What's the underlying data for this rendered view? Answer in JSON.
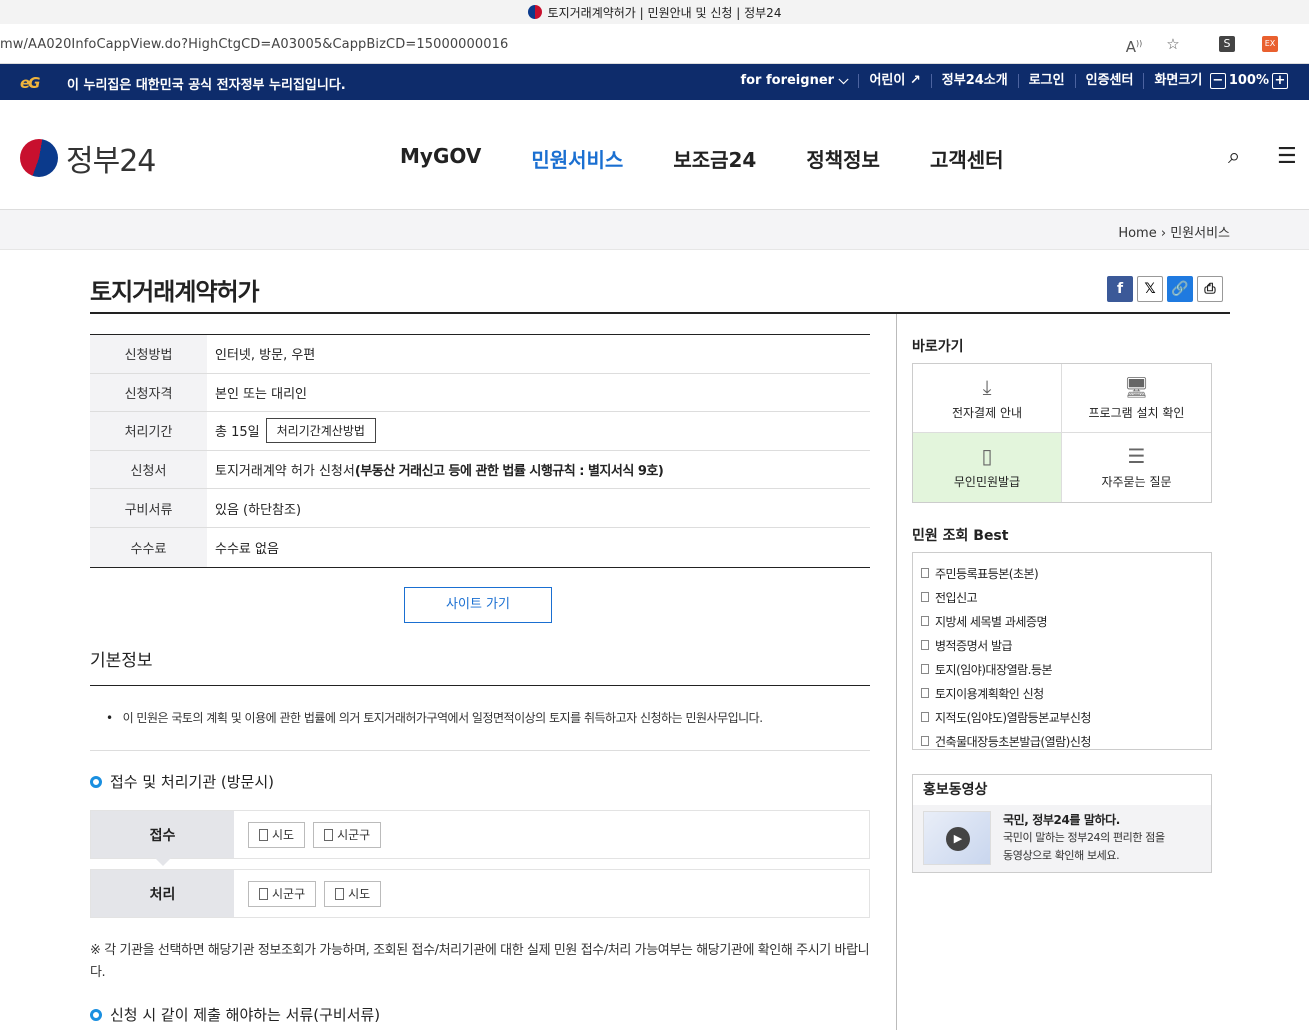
{
  "browser": {
    "window_title": "토지거래계약허가 | 민원안내 및 신청 | 정부24",
    "url": "mw/AA020InfoCappView.do?HighCtgCD=A03005&CappBizCD=15000000016",
    "ext_s": "S",
    "ext_ex": "EX"
  },
  "gov_banner": {
    "logo_text": "eG",
    "notice": "이 누리집은 대한민국 공식 전자정부 누리집입니다.",
    "foreigner": "for foreigner",
    "kids": "어린이",
    "about": "정부24소개",
    "login": "로그인",
    "cert": "인증센터",
    "screen_size": "화면크기",
    "zoom": "100%"
  },
  "header": {
    "logo": "정부24",
    "nav": [
      "MyGOV",
      "민원서비스",
      "보조금24",
      "정책정보",
      "고객센터"
    ],
    "active_index": 1
  },
  "breadcrumb": {
    "home": "Home",
    "current": "민원서비스"
  },
  "page": {
    "title": "토지거래계약허가",
    "info_rows": [
      {
        "label": "신청방법",
        "value": "인터넷, 방문, 우편"
      },
      {
        "label": "신청자격",
        "value": "본인 또는 대리인"
      },
      {
        "label": "처리기간",
        "value": "총 15일",
        "button": "처리기간계산방법"
      },
      {
        "label": "신청서",
        "value": "토지거래계약 허가 신청서 ",
        "value_bold": "(부동산 거래신고 등에 관한 법률 시행규칙 : 별지서식 9호)"
      },
      {
        "label": "구비서류",
        "value": "있음 (하단참조)"
      },
      {
        "label": "수수료",
        "value": "수수료 없음"
      }
    ],
    "site_button": "사이트 가기",
    "basic_info_title": "기본정보",
    "basic_info_bullet": "이 민원은 국토의 계획 및 이용에 관한 법률에 의거 토지거래허가구역에서 일정면적이상의 토지를 취득하고자 신청하는 민원사무입니다.",
    "agency_title": "접수 및 처리기관 (방문시)",
    "reception_label": "접수",
    "reception_items": [
      "시도",
      "시군구"
    ],
    "processing_label": "처리",
    "processing_items": [
      "시군구",
      "시도"
    ],
    "agency_note": "※ 각 기관을 선택하면 해당기관 정보조회가 가능하며, 조회된 접수/처리기관에 대한 실제 민원 접수/처리 가능여부는 해당기관에 확인해 주시기 바랍니다.",
    "docs_title": "신청 시 같이 제출 해야하는 서류(구비서류)"
  },
  "sidebar": {
    "quick_title": "바로가기",
    "quick": [
      {
        "label": "전자결제 안내",
        "icon": "download-icon"
      },
      {
        "label": "프로그램 설치 확인",
        "icon": "monitor-check-icon"
      },
      {
        "label": "무인민원발급",
        "icon": "kiosk-icon"
      },
      {
        "label": "자주묻는 질문",
        "icon": "chat-icon"
      }
    ],
    "best_title": "민원 조회 Best",
    "best": [
      "주민등록표등본(초본)",
      "전입신고",
      "지방세 세목별 과세증명",
      "병적증명서 발급",
      "토지(임야)대장열람.등본",
      "토지이용계획확인 신청",
      "지적도(임야도)열람등본교부신청",
      "건축물대장등초본발급(열람)신청"
    ],
    "promo_title": "홍보동영상",
    "promo_headline": "국민, 정부24를 말하다.",
    "promo_line1": "국민이 말하는 정부24의 편리한 점을",
    "promo_line2": "동영상으로 확인해 보세요."
  }
}
